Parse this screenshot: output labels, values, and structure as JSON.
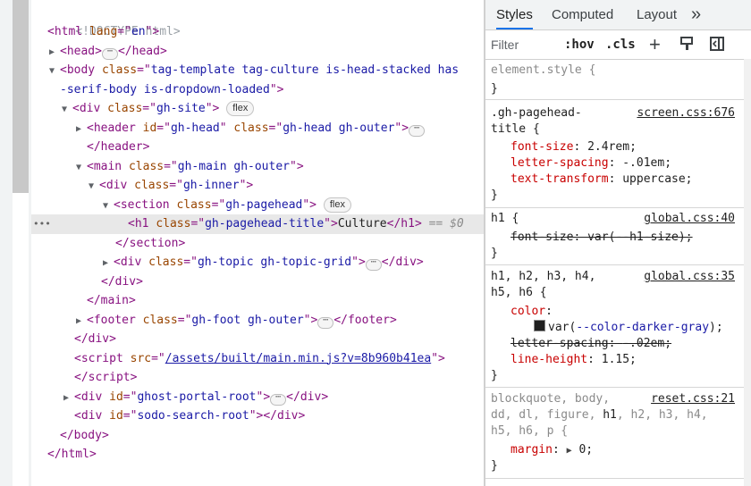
{
  "dom": {
    "doctype": "<!DOCTYPE html>",
    "html_open": {
      "tag": "html",
      "attr": "lang",
      "value": "en"
    },
    "head": {
      "tag": "head"
    },
    "body_open": {
      "tag": "body",
      "attr": "class",
      "value_line1": "tag-template tag-culture is-head-stacked has",
      "value_line2": "-serif-body is-dropdown-loaded"
    },
    "site": {
      "tag": "div",
      "attr": "class",
      "value": "gh-site",
      "badge": "flex"
    },
    "header": {
      "tag": "header",
      "attr1": "id",
      "value1": "gh-head",
      "attr2": "class",
      "value2": "gh-head gh-outer"
    },
    "header_close": "header",
    "main": {
      "tag": "main",
      "attr": "class",
      "value": "gh-main gh-outer"
    },
    "inner": {
      "tag": "div",
      "attr": "class",
      "value": "gh-inner"
    },
    "section": {
      "tag": "section",
      "attr": "class",
      "value": "gh-pagehead",
      "badge": "flex"
    },
    "h1": {
      "tag": "h1",
      "attr": "class",
      "value": "gh-pagehead-title",
      "text": "Culture",
      "eq": "== $0",
      "gutter": "•••"
    },
    "section_close": "section",
    "topic": {
      "tag": "div",
      "attr": "class",
      "value": "gh-topic gh-topic-grid"
    },
    "inner_close": "div",
    "main_close": "main",
    "footer": {
      "tag": "footer",
      "attr": "class",
      "value": "gh-foot gh-outer"
    },
    "site_close": "div",
    "script": {
      "tag": "script",
      "attr": "src",
      "value": "/assets/built/main.min.js?v=8b960b41ea"
    },
    "script_close": "script",
    "portal": {
      "tag": "div",
      "attr": "id",
      "value": "ghost-portal-root"
    },
    "sodo": {
      "tag": "div",
      "attr": "id",
      "value": "sodo-search-root"
    },
    "body_close": "body",
    "html_close": "html",
    "ellipsis": "⋯"
  },
  "styles": {
    "tabs": [
      "Styles",
      "Computed",
      "Layout"
    ],
    "more_tabs_icon": "»",
    "filter_placeholder": "Filter",
    "hov": ":hov",
    "cls": ".cls",
    "plus_icon": "+",
    "rules": [
      {
        "selector": "element.style {",
        "close": "}"
      },
      {
        "selector_line1": ".gh-pagehead-",
        "selector_line2": "title {",
        "source": "screen.css:676",
        "decls": [
          {
            "prop": "font-size",
            "value": "2.4rem;"
          },
          {
            "prop": "letter-spacing",
            "value": "-.01em;"
          },
          {
            "prop": "text-transform",
            "value": "uppercase;"
          }
        ],
        "close": "}"
      },
      {
        "selector": "h1 {",
        "source": "global.css:40",
        "decls": [
          {
            "prop": "font-size",
            "value_pre": "var(",
            "value_var": "--h1-size",
            "value_post": ");"
          }
        ],
        "close": "}"
      },
      {
        "selector_line1": "h1, h2, h3, h4,",
        "selector_line2": "h5, h6 {",
        "source": "global.css:35",
        "decls": [
          {
            "prop": "color",
            "value_pre": "var(",
            "value_var": "--color-darker-gray",
            "value_post": ");"
          },
          {
            "prop": "letter-spacing",
            "value": "-.02em;"
          },
          {
            "prop": "line-height",
            "value": "1.15;"
          }
        ],
        "close": "}"
      },
      {
        "sel_a": "blockquote, body,",
        "source": "reset.css:21",
        "sel_b": "dd, dl, figure, ",
        "sel_b_match": "h1",
        "sel_b_rest": ", h2, h3, h4,",
        "sel_c": "h5, h6, p {",
        "decls": [
          {
            "prop": "margin",
            "value": "0;"
          }
        ],
        "close": "}"
      }
    ],
    "colors": {
      "tag": "#881280",
      "attr": "#994500",
      "value": "#1a1aa6",
      "prop": "#c80000",
      "accent": "#1a73e8"
    }
  }
}
